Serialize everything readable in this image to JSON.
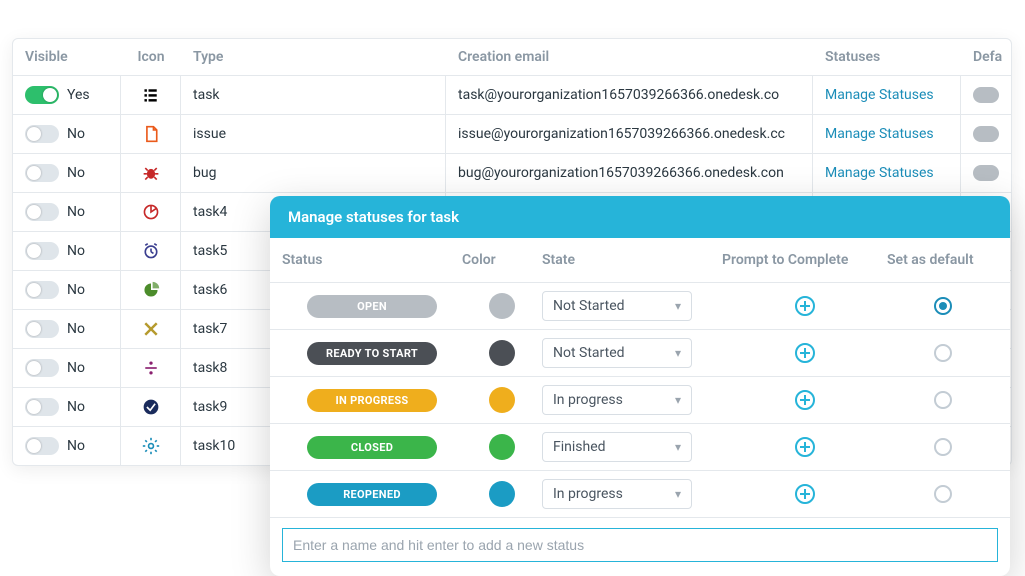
{
  "table": {
    "headers": {
      "visible": "Visible",
      "icon": "Icon",
      "type": "Type",
      "email": "Creation email",
      "statuses": "Statuses",
      "default": "Defa"
    },
    "manage_label": "Manage Statuses",
    "yes": "Yes",
    "no": "No",
    "rows": [
      {
        "visible": true,
        "type": "task",
        "email": "task@yourorganization1657039266366.onedesk.co",
        "icon": "list-icon",
        "icon_color": "#3a3e8f"
      },
      {
        "visible": false,
        "type": "issue",
        "email": "issue@yourorganization1657039266366.onedesk.cc",
        "icon": "file-icon",
        "icon_color": "#ea5a1b"
      },
      {
        "visible": false,
        "type": "bug",
        "email": "bug@yourorganization1657039266366.onedesk.con",
        "icon": "bug-icon",
        "icon_color": "#c62828"
      },
      {
        "visible": false,
        "type": "task4",
        "email": "",
        "icon": "target-icon",
        "icon_color": "#c62828"
      },
      {
        "visible": false,
        "type": "task5",
        "email": "",
        "icon": "alarm-icon",
        "icon_color": "#3a3e8f"
      },
      {
        "visible": false,
        "type": "task6",
        "email": "",
        "icon": "pie-icon",
        "icon_color": "#4c8c2b"
      },
      {
        "visible": false,
        "type": "task7",
        "email": "",
        "icon": "x-icon",
        "icon_color": "#b59a2d"
      },
      {
        "visible": false,
        "type": "task8",
        "email": "",
        "icon": "divide-icon",
        "icon_color": "#8a1f6f"
      },
      {
        "visible": false,
        "type": "task9",
        "email": "",
        "icon": "check-circle-icon",
        "icon_color": "#1a2b5c"
      },
      {
        "visible": false,
        "type": "task10",
        "email": "",
        "icon": "gear-icon",
        "icon_color": "#1b8db8"
      }
    ]
  },
  "modal": {
    "title": "Manage statuses for task",
    "headers": {
      "status": "Status",
      "color": "Color",
      "state": "State",
      "prompt": "Prompt to Complete",
      "default": "Set as default"
    },
    "new_placeholder": "Enter a name and hit enter to add a new status",
    "statuses": [
      {
        "label": "OPEN",
        "color": "#b7bdc3",
        "state": "Not Started",
        "default": true
      },
      {
        "label": "READY TO START",
        "color": "#4b4f55",
        "state": "Not Started",
        "default": false
      },
      {
        "label": "IN PROGRESS",
        "color": "#efae1d",
        "state": "In progress",
        "default": false
      },
      {
        "label": "CLOSED",
        "color": "#3bb54a",
        "state": "Finished",
        "default": false
      },
      {
        "label": "REOPENED",
        "color": "#1b9cc4",
        "state": "In progress",
        "default": false
      }
    ]
  }
}
